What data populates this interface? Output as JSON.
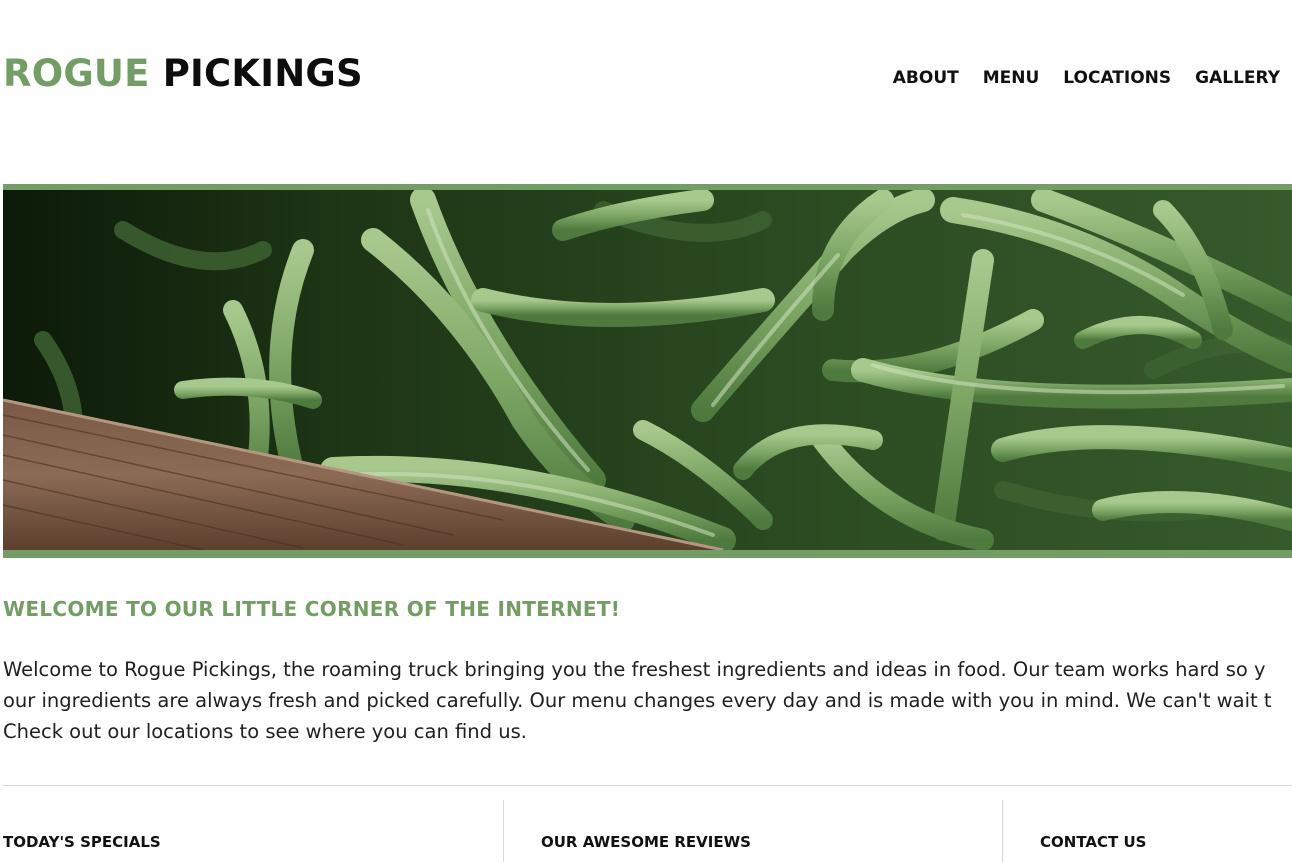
{
  "brand": {
    "part1": "ROGUE",
    "part2": "PICKINGS",
    "accent_color": "#749c65"
  },
  "nav": {
    "items": [
      "ABOUT",
      "MENU",
      "LOCATIONS",
      "GALLERY"
    ]
  },
  "hero": {
    "image_subject": "green beans in a wooden crate"
  },
  "welcome": {
    "title": "WELCOME TO OUR LITTLE CORNER OF THE INTERNET!",
    "lines": [
      "Welcome to Rogue Pickings, the roaming truck bringing you the freshest ingredients and ideas in food. Our team works hard so y",
      "our ingredients are always fresh and picked carefully. Our menu changes every day and is made with you in mind. We can't wait t",
      "Check out our locations to see where you can find us."
    ]
  },
  "footer_columns": {
    "specials": "TODAY'S SPECIALS",
    "reviews": "OUR AWESOME REVIEWS",
    "contact": "CONTACT US"
  }
}
